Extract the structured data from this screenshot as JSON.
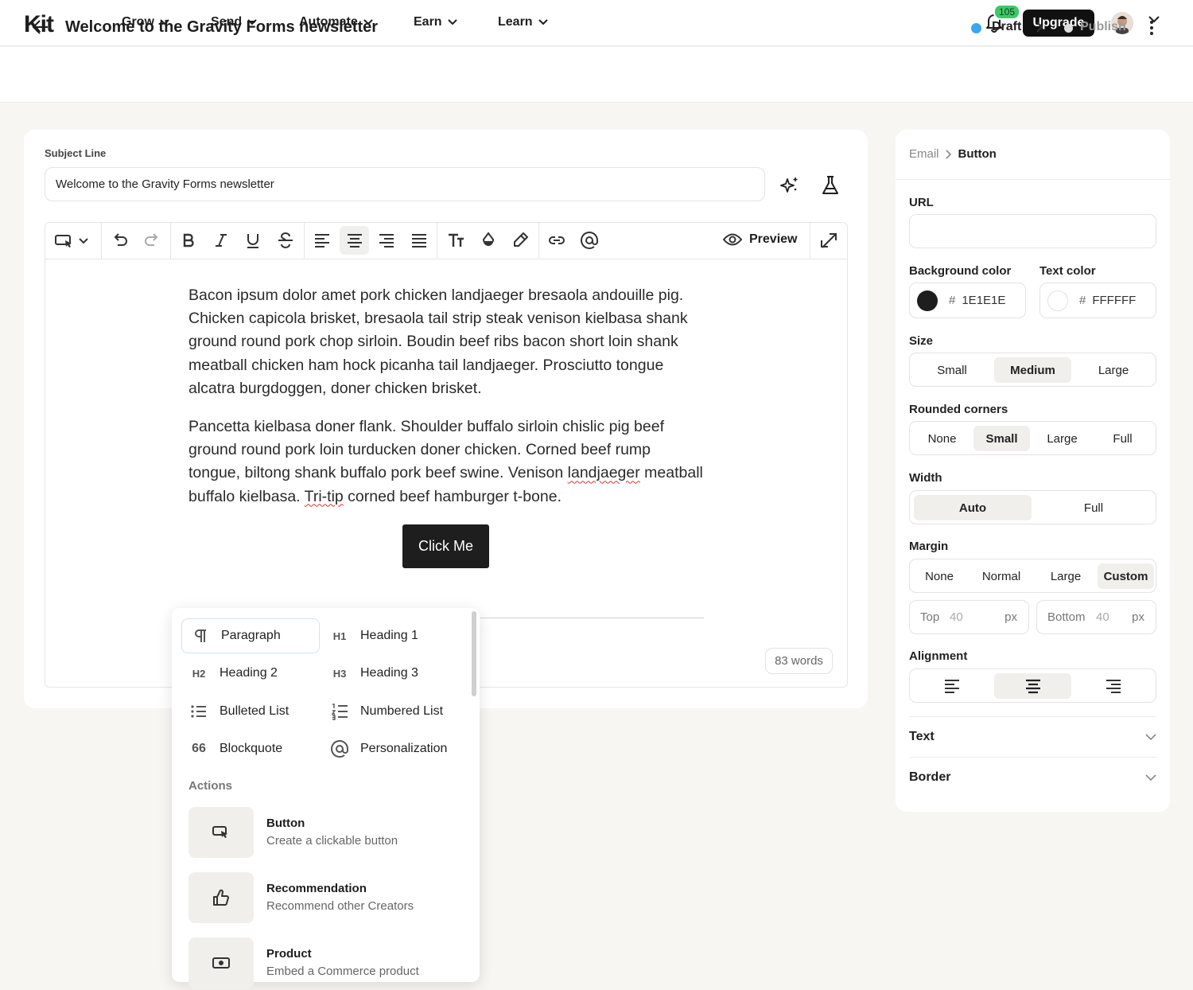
{
  "brand": "Kit",
  "nav": {
    "items": [
      "Grow",
      "Send",
      "Automate",
      "Earn",
      "Learn"
    ],
    "notifications": "105",
    "upgrade": "Upgrade"
  },
  "header": {
    "title": "Welcome to the Gravity Forms newsletter",
    "draft": "Draft",
    "publish": "Publish"
  },
  "editor": {
    "subject_label": "Subject Line",
    "subject_value": "Welcome to the Gravity Forms newsletter",
    "preview": "Preview",
    "p1_lines": [
      "Bacon ipsum dolor amet pork chicken landjaeger bresaola andouille pig.",
      "Chicken capicola brisket, bresaola tail strip steak venison kielbasa shank",
      "ground round pork chop sirloin. Boudin beef ribs bacon short loin shank",
      "meatball chicken ham hock picanha tail landjaeger. Prosciutto tongue",
      "alcatra burgdoggen, doner chicken brisket."
    ],
    "p2_lines": [
      "Pancetta kielbasa doner flank. Shoulder buffalo sirloin chislic pig beef",
      "ground round pork loin turducken doner chicken. Corned beef rump",
      "tongue, biltong shank buffalo pork beef swine. Venison ",
      "landjaeger",
      " meatball",
      "buffalo kielbasa. ",
      "Tri-tip",
      " corned beef hamburger t-bone."
    ],
    "button_label": "Click Me",
    "word_count": "83 words"
  },
  "menu": {
    "blocks": [
      {
        "icon": "paragraph-icon",
        "label": "Paragraph"
      },
      {
        "icon": "H1",
        "label": "Heading 1"
      },
      {
        "icon": "H2",
        "label": "Heading 2"
      },
      {
        "icon": "H3",
        "label": "Heading 3"
      },
      {
        "icon": "bulleted-list-icon",
        "label": "Bulleted List"
      },
      {
        "icon": "numbered-list-icon",
        "label": "Numbered List"
      },
      {
        "icon": "66",
        "label": "Blockquote"
      },
      {
        "icon": "at-icon",
        "label": "Personalization"
      }
    ],
    "actions_label": "Actions",
    "actions": [
      {
        "title": "Button",
        "subtitle": "Create a clickable button",
        "icon": "button-cursor-icon"
      },
      {
        "title": "Recommendation",
        "subtitle": "Recommend other Creators",
        "icon": "thumbs-up-icon"
      },
      {
        "title": "Product",
        "subtitle": "Embed a Commerce product",
        "icon": "product-icon"
      }
    ]
  },
  "panel": {
    "crumb_root": "Email",
    "crumb_current": "Button",
    "url_label": "URL",
    "url_value": "",
    "bg_color_label": "Background color",
    "bg_color": "1E1E1E",
    "bg_color_hex": "#1E1E1E",
    "text_color_label": "Text color",
    "text_color": "FFFFFF",
    "text_color_hex": "#FFFFFF",
    "hash": "#",
    "size_label": "Size",
    "size_options": [
      "Small",
      "Medium",
      "Large"
    ],
    "size_selected": "Medium",
    "corners_label": "Rounded corners",
    "corner_options": [
      "None",
      "Small",
      "Large",
      "Full"
    ],
    "corner_selected": "Small",
    "width_label": "Width",
    "width_options": [
      "Auto",
      "Full"
    ],
    "width_selected": "Auto",
    "margin_label": "Margin",
    "margin_options": [
      "None",
      "Normal",
      "Large",
      "Custom"
    ],
    "margin_selected": "Custom",
    "margin_top_label": "Top",
    "margin_top": "40",
    "margin_bottom_label": "Bottom",
    "margin_bottom": "40",
    "px": "px",
    "alignment_label": "Alignment",
    "alignment_selected": "center",
    "text_section": "Text",
    "border_section": "Border"
  },
  "colors": {
    "accent_blue": "#3aa7f0",
    "badge_green": "#3cc96a",
    "dark": "#1e1e1e"
  }
}
